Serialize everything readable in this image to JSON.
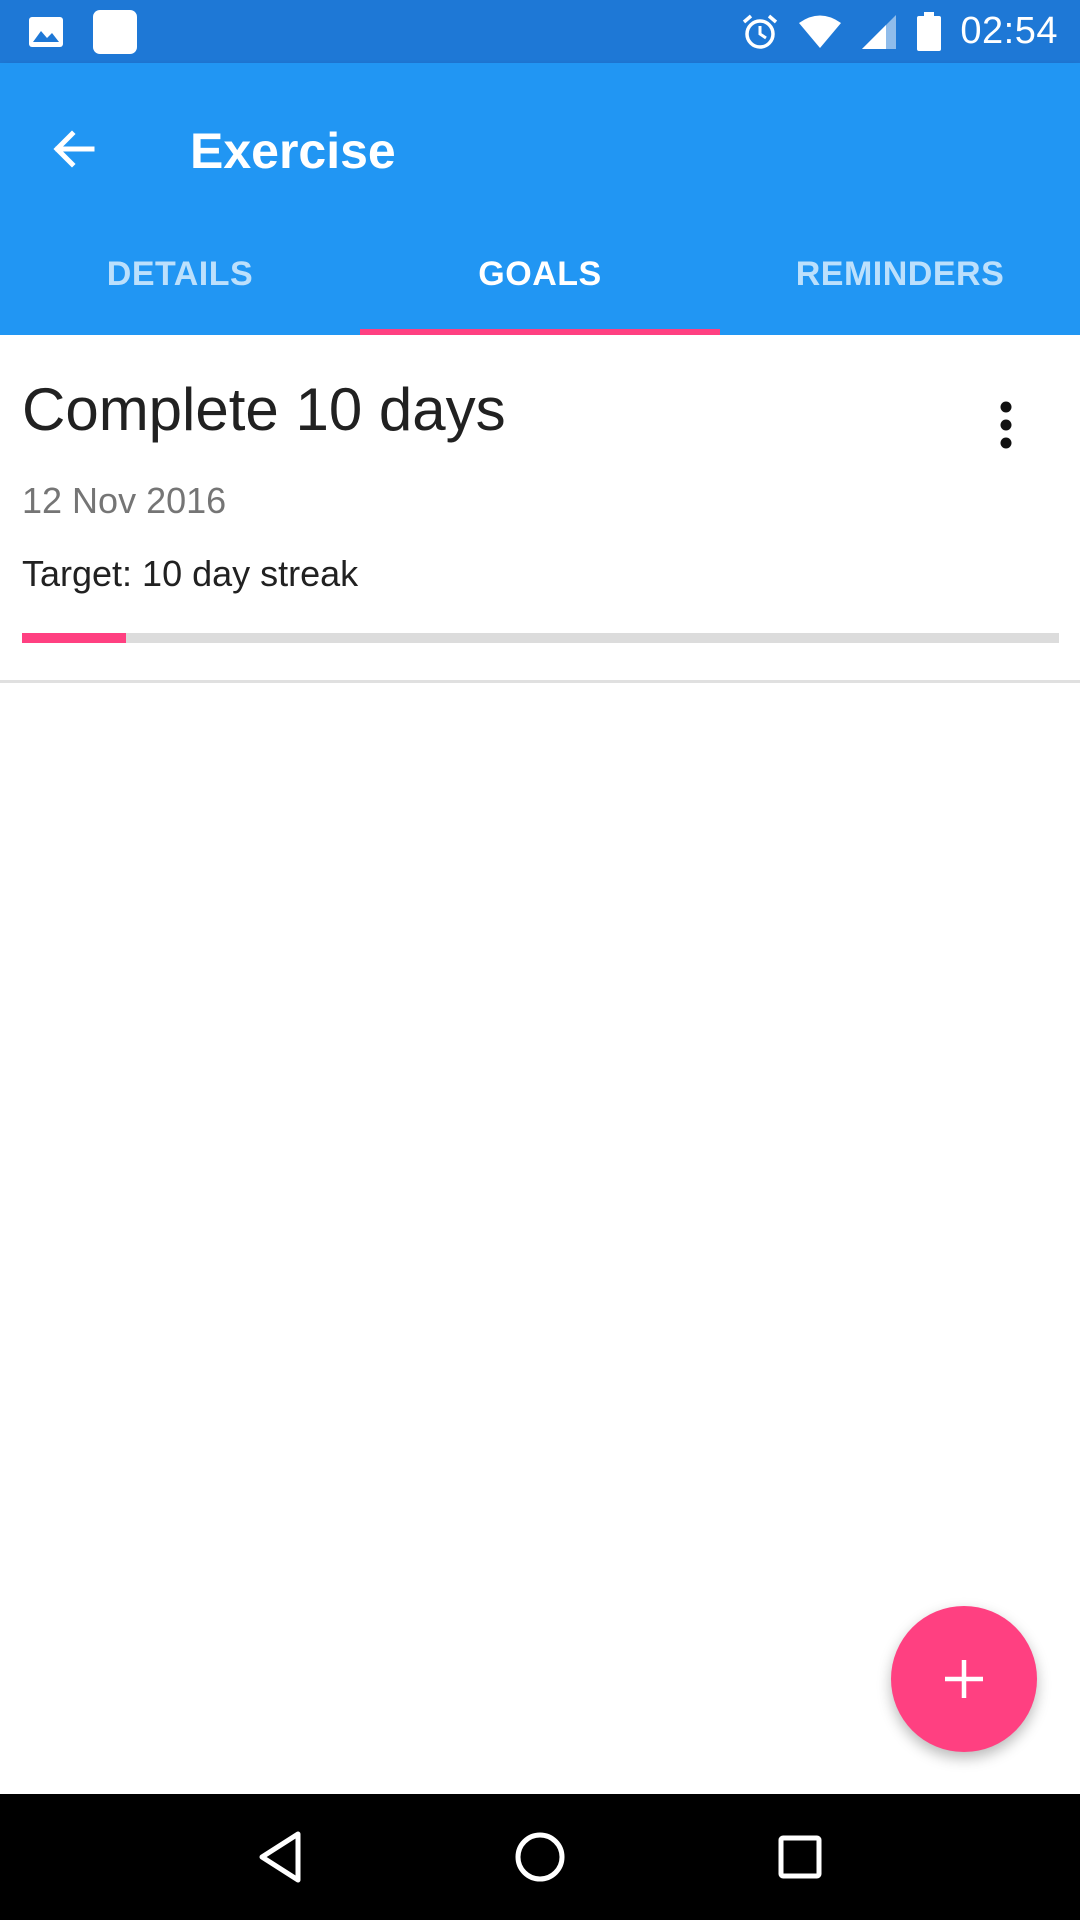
{
  "status_bar": {
    "time": "02:54",
    "icons": [
      "image-notification-icon",
      "app-notification-icon",
      "alarm-icon",
      "wifi-icon",
      "cellular-signal-icon",
      "battery-icon"
    ]
  },
  "app_bar": {
    "title": "Exercise",
    "back_icon": "arrow-back-icon",
    "color": "#2196f3"
  },
  "tabs": [
    {
      "label": "DETAILS",
      "active": false
    },
    {
      "label": "GOALS",
      "active": true
    },
    {
      "label": "REMINDERS",
      "active": false
    }
  ],
  "goal": {
    "title": "Complete 10 days",
    "date": "12 Nov 2016",
    "target": "Target: 10 day streak",
    "progress_fraction": 0.1,
    "more_icon": "more-vert-icon"
  },
  "fab": {
    "icon": "add-icon",
    "color": "#ff4081"
  },
  "accent_color": "#ff4081",
  "nav_bar": {
    "icons": [
      "back-triangle-icon",
      "home-circle-icon",
      "recents-square-icon"
    ]
  }
}
